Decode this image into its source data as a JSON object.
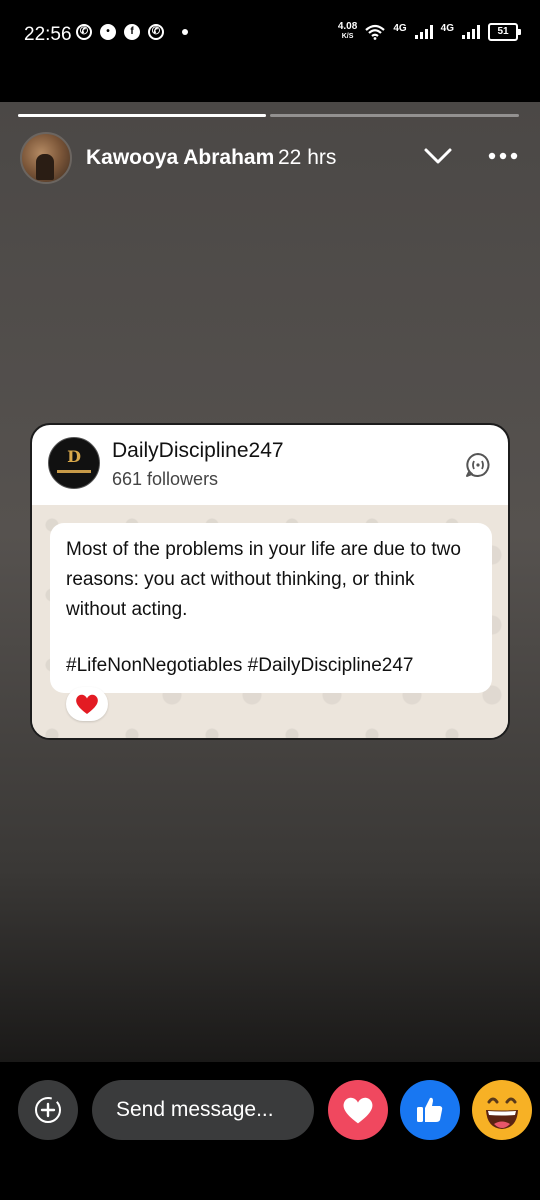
{
  "status_bar": {
    "time": "22:56",
    "speed_value": "4.08",
    "speed_unit": "K/S",
    "network_1": "4G",
    "network_2": "4G",
    "battery": "51"
  },
  "story": {
    "progress": [
      1.0,
      0.0
    ],
    "author": "Kawooya Abraham",
    "time": "22 hrs"
  },
  "card": {
    "channel_name": "DailyDiscipline247",
    "followers": "661 followers",
    "avatar_letter": "D",
    "message": "Most of the problems in your life are due to two reasons: you act without thinking, or think without acting.",
    "hashtags": "#LifeNonNegotiables #DailyDiscipline247",
    "reaction": "❤️"
  },
  "bottom_bar": {
    "placeholder": "Send message..."
  },
  "colors": {
    "heart": "#f0485f",
    "like": "#1877f2",
    "haha": "#f7b125"
  }
}
